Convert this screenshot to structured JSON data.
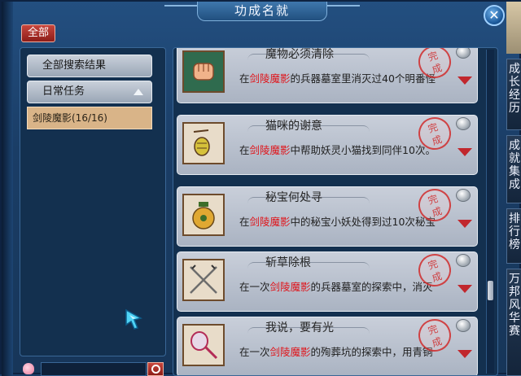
{
  "window": {
    "title": "功成名就",
    "close_label": "✕"
  },
  "filter": {
    "all_label": "全部"
  },
  "left_panel": {
    "tabs": [
      {
        "label": "全部搜索结果"
      },
      {
        "label": "日常任务"
      }
    ],
    "selected_item": "剑陵魔影(16/16)"
  },
  "achievements": [
    {
      "title": "魔物必须清除",
      "prefix": "在",
      "highlight": "剑陵魔影",
      "suffix": "的兵器墓室里消灭过40个明番怪",
      "stamp": "完成",
      "icon": "fist-icon"
    },
    {
      "title": "猫咪的谢意",
      "prefix": "在",
      "highlight": "剑陵魔影",
      "suffix": "中帮助妖灵小猫找到同伴10次。",
      "stamp": "完成",
      "icon": "lantern-icon"
    },
    {
      "title": "秘宝何处寻",
      "prefix": "在",
      "highlight": "剑陵魔影",
      "suffix": "中的秘宝小妖处得到过10次秘宝",
      "stamp": "完成",
      "icon": "jar-icon"
    },
    {
      "title": "斩草除根",
      "prefix": "在一次",
      "highlight": "剑陵魔影",
      "suffix": "的兵器墓室的探索中，消灭",
      "stamp": "完成",
      "icon": "crossed-swords-icon"
    },
    {
      "title": "我说，要有光",
      "prefix": "在一次",
      "highlight": "剑陵魔影",
      "suffix": "的殉葬坑的探索中，用青铜",
      "stamp": "完成",
      "icon": "mirror-icon"
    }
  ],
  "side_tabs": [
    {
      "label": "成长经历"
    },
    {
      "label": "成就集成"
    },
    {
      "label": "排行榜"
    },
    {
      "label": "万邦风华赛"
    }
  ]
}
